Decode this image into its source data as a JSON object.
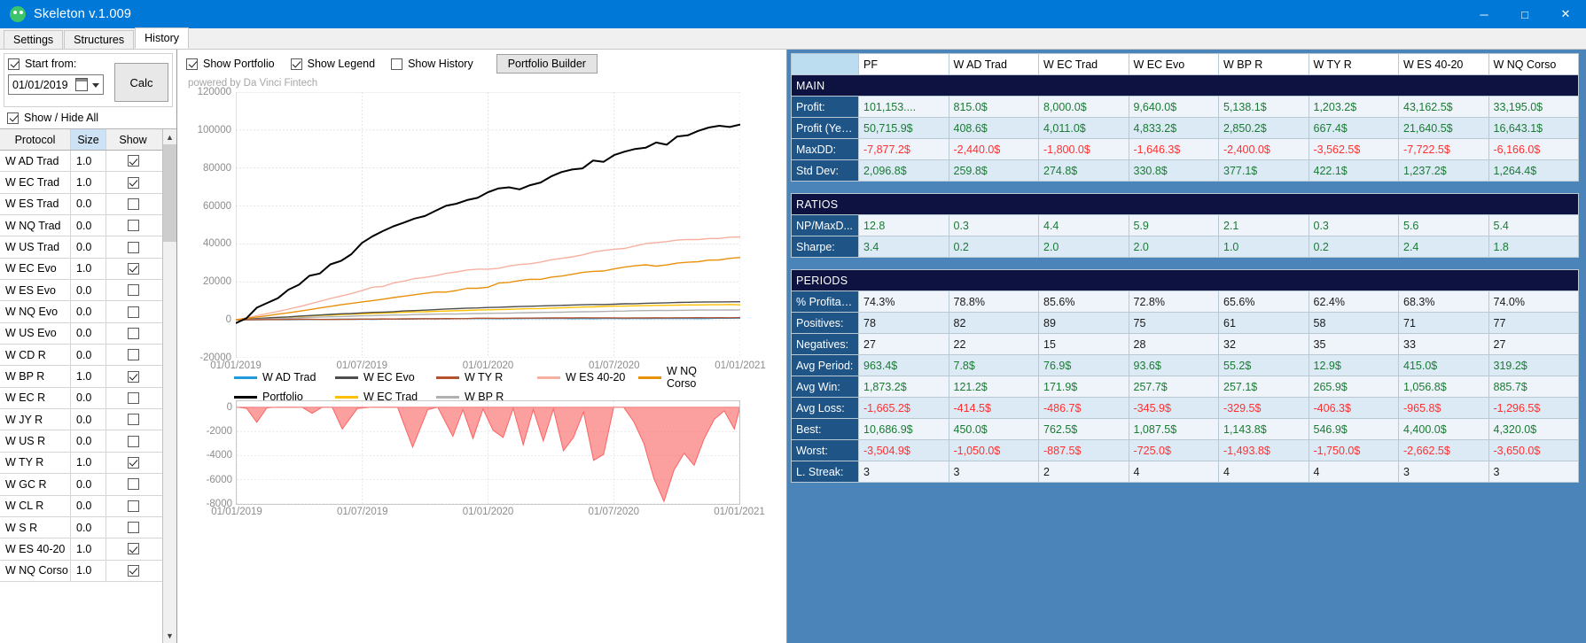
{
  "window": {
    "title": "Skeleton v.1.009",
    "icon": "skull-icon",
    "minimize": "─",
    "maximize": "□",
    "close": "✕"
  },
  "tabs": [
    {
      "label": "Settings",
      "active": false
    },
    {
      "label": "Structures",
      "active": false
    },
    {
      "label": "History",
      "active": true
    }
  ],
  "left": {
    "start_from_label": "Start from:",
    "start_from_checked": true,
    "date_value": "01/01/2019",
    "calc_label": "Calc",
    "show_hide_all_label": "Show / Hide All",
    "show_hide_all_checked": true,
    "columns": [
      "Protocol",
      "Size",
      "Show"
    ],
    "rows": [
      {
        "protocol": "W AD Trad",
        "size": "1.0",
        "show": true
      },
      {
        "protocol": "W EC Trad",
        "size": "1.0",
        "show": true
      },
      {
        "protocol": "W ES Trad",
        "size": "0.0",
        "show": false
      },
      {
        "protocol": "W NQ Trad",
        "size": "0.0",
        "show": false
      },
      {
        "protocol": "W US Trad",
        "size": "0.0",
        "show": false
      },
      {
        "protocol": "W EC Evo",
        "size": "1.0",
        "show": true
      },
      {
        "protocol": "W ES Evo",
        "size": "0.0",
        "show": false
      },
      {
        "protocol": "W NQ Evo",
        "size": "0.0",
        "show": false
      },
      {
        "protocol": "W US Evo",
        "size": "0.0",
        "show": false
      },
      {
        "protocol": "W CD R",
        "size": "0.0",
        "show": false
      },
      {
        "protocol": "W BP R",
        "size": "1.0",
        "show": true
      },
      {
        "protocol": "W EC R",
        "size": "0.0",
        "show": false
      },
      {
        "protocol": "W JY R",
        "size": "0.0",
        "show": false
      },
      {
        "protocol": "W US R",
        "size": "0.0",
        "show": false
      },
      {
        "protocol": "W TY R",
        "size": "1.0",
        "show": true
      },
      {
        "protocol": "W GC R",
        "size": "0.0",
        "show": false
      },
      {
        "protocol": "W CL R",
        "size": "0.0",
        "show": false
      },
      {
        "protocol": "W S R",
        "size": "0.0",
        "show": false
      },
      {
        "protocol": "W ES 40-20",
        "size": "1.0",
        "show": true
      },
      {
        "protocol": "W NQ Corso",
        "size": "1.0",
        "show": true
      }
    ]
  },
  "chart_toolbar": {
    "show_portfolio": {
      "label": "Show Portfolio",
      "checked": true
    },
    "show_legend": {
      "label": "Show Legend",
      "checked": true
    },
    "show_history": {
      "label": "Show History",
      "checked": false
    },
    "portfolio_builder": "Portfolio Builder"
  },
  "chart_data": [
    {
      "type": "line",
      "name": "equity-curve",
      "title": "",
      "watermark": "powered by Da Vinci Fintech",
      "xlabel": "",
      "ylabel": "",
      "ylim": [
        -20000,
        120000
      ],
      "yticks": [
        -20000,
        0,
        20000,
        40000,
        60000,
        80000,
        100000,
        120000
      ],
      "xticks": [
        "01/01/2019",
        "01/07/2019",
        "01/01/2020",
        "01/07/2020",
        "01/01/2021"
      ],
      "grid": true,
      "legend_position": "bottom",
      "x": [
        0,
        4.2,
        8.3,
        12.5,
        16.7,
        20.8,
        25,
        29.2,
        33.3,
        37.5,
        41.7,
        45.8,
        50,
        54.2,
        58.3,
        62.5,
        66.7,
        70.8,
        75,
        79.2,
        83.3,
        87.5,
        91.7,
        95.8,
        100
      ],
      "series": [
        {
          "name": "W AD Trad",
          "color": "#1f9bde",
          "values": [
            0,
            100,
            180,
            240,
            300,
            360,
            400,
            430,
            470,
            510,
            550,
            580,
            610,
            640,
            670,
            690,
            710,
            730,
            750,
            770,
            785,
            795,
            805,
            810,
            815
          ]
        },
        {
          "name": "W EC Trad",
          "color": "#ffc000",
          "values": [
            0,
            500,
            1100,
            1700,
            2200,
            2700,
            3100,
            3500,
            3900,
            4300,
            4700,
            5000,
            5300,
            5600,
            5900,
            6200,
            6500,
            6800,
            7100,
            7350,
            7550,
            7700,
            7850,
            7930,
            8000
          ]
        },
        {
          "name": "W EC Evo",
          "color": "#4d4d4d",
          "values": [
            0,
            600,
            1300,
            2000,
            2600,
            3200,
            3700,
            4200,
            4700,
            5200,
            5700,
            6100,
            6450,
            6800,
            7150,
            7450,
            7750,
            8050,
            8350,
            8650,
            8950,
            9200,
            9400,
            9550,
            9640
          ]
        },
        {
          "name": "W BP R",
          "color": "#b0b0b0",
          "values": [
            0,
            300,
            700,
            1100,
            1400,
            1700,
            2000,
            2300,
            2550,
            2800,
            3050,
            3250,
            3450,
            3650,
            3850,
            4050,
            4250,
            4400,
            4550,
            4700,
            4850,
            4950,
            5050,
            5100,
            5138
          ]
        },
        {
          "name": "W TY R",
          "color": "#b4512e",
          "values": [
            0,
            80,
            150,
            220,
            290,
            360,
            430,
            490,
            550,
            610,
            670,
            720,
            770,
            820,
            870,
            910,
            950,
            990,
            1030,
            1070,
            1110,
            1140,
            1170,
            1190,
            1203
          ]
        },
        {
          "name": "W ES 40-20",
          "color": "#f6b0a0",
          "values": [
            0,
            2200,
            4500,
            7000,
            9800,
            12500,
            15200,
            17500,
            19800,
            22000,
            23800,
            25500,
            27000,
            28500,
            30000,
            31800,
            33800,
            35800,
            37500,
            39000,
            40200,
            41200,
            42100,
            42700,
            43162
          ]
        },
        {
          "name": "W NQ Corso",
          "color": "#e8910c",
          "values": [
            0,
            1400,
            2900,
            4500,
            6200,
            7900,
            9500,
            11000,
            12500,
            14000,
            15400,
            16700,
            18000,
            19300,
            20600,
            22000,
            23400,
            24800,
            26200,
            27600,
            29000,
            30200,
            31400,
            32400,
            33195
          ]
        },
        {
          "name": "Portfolio",
          "color": "#000000",
          "values": [
            0,
            6500,
            13500,
            20500,
            27000,
            33500,
            39000,
            44500,
            49800,
            54500,
            58500,
            62500,
            66000,
            69500,
            73000,
            76500,
            80500,
            84000,
            87500,
            90500,
            93500,
            96000,
            98000,
            99800,
            101153
          ]
        }
      ]
    },
    {
      "type": "area",
      "name": "drawdown-curve",
      "color": "#fa6464",
      "ylim": [
        -8000,
        500
      ],
      "yticks": [
        0,
        -2000,
        -4000,
        -6000,
        -8000
      ],
      "xticks": [
        "01/01/2019",
        "01/07/2019",
        "01/01/2020",
        "01/07/2020",
        "01/01/2021"
      ],
      "x": [
        0,
        2,
        4,
        6,
        8,
        11,
        13,
        15,
        17,
        19,
        21,
        24,
        27,
        30,
        32,
        35,
        38,
        40,
        43,
        45,
        47,
        49,
        51,
        53,
        55,
        57,
        59,
        61,
        63,
        65,
        67,
        69,
        71,
        73,
        75,
        77,
        79,
        81,
        83,
        85,
        87,
        89,
        91,
        93,
        95,
        97,
        99,
        100
      ],
      "values": [
        0,
        -100,
        -1250,
        -50,
        0,
        0,
        0,
        -500,
        0,
        0,
        -1800,
        -100,
        0,
        0,
        0,
        -3300,
        -200,
        0,
        -2400,
        -200,
        -2600,
        -150,
        -1900,
        -2500,
        -100,
        -3100,
        -200,
        -2800,
        -150,
        -3600,
        -2500,
        -400,
        -4400,
        -3900,
        0,
        0,
        -1200,
        -3000,
        -5900,
        -7800,
        -5200,
        -3800,
        -4800,
        -2600,
        -1000,
        -300,
        -1800,
        -200
      ]
    }
  ],
  "legend": [
    {
      "label": "W AD Trad",
      "color": "#1f9bde"
    },
    {
      "label": "W EC Evo",
      "color": "#4d4d4d"
    },
    {
      "label": "W TY R",
      "color": "#b4512e"
    },
    {
      "label": "W ES 40-20",
      "color": "#f6b0a0"
    },
    {
      "label": "W NQ Corso",
      "color": "#e8910c"
    },
    {
      "label": "Portfolio",
      "color": "#000000"
    },
    {
      "label": "W EC Trad",
      "color": "#ffc000"
    },
    {
      "label": "W BP R",
      "color": "#b0b0b0"
    }
  ],
  "stats": {
    "columns": [
      "",
      "PF",
      "W AD Trad",
      "W EC Trad",
      "W EC Evo",
      "W BP R",
      "W TY R",
      "W ES 40-20",
      "W NQ Corso"
    ],
    "sections": [
      {
        "title": "MAIN",
        "rows": [
          {
            "label": "Profit:",
            "values": [
              "101,153....",
              "815.0$",
              "8,000.0$",
              "9,640.0$",
              "5,138.1$",
              "1,203.2$",
              "43,162.5$",
              "33,195.0$"
            ],
            "tone": "pos"
          },
          {
            "label": "Profit (Year):",
            "values": [
              "50,715.9$",
              "408.6$",
              "4,011.0$",
              "4,833.2$",
              "2,850.2$",
              "667.4$",
              "21,640.5$",
              "16,643.1$"
            ],
            "tone": "pos"
          },
          {
            "label": "MaxDD:",
            "values": [
              "-7,877.2$",
              "-2,440.0$",
              "-1,800.0$",
              "-1,646.3$",
              "-2,400.0$",
              "-3,562.5$",
              "-7,722.5$",
              "-6,166.0$"
            ],
            "tone": "neg"
          },
          {
            "label": "Std Dev:",
            "values": [
              "2,096.8$",
              "259.8$",
              "274.8$",
              "330.8$",
              "377.1$",
              "422.1$",
              "1,237.2$",
              "1,264.4$"
            ],
            "tone": "pos"
          }
        ]
      },
      {
        "title": "RATIOS",
        "rows": [
          {
            "label": "NP/MaxD...",
            "values": [
              "12.8",
              "0.3",
              "4.4",
              "5.9",
              "2.1",
              "0.3",
              "5.6",
              "5.4"
            ],
            "tone": "pos"
          },
          {
            "label": "Sharpe:",
            "values": [
              "3.4",
              "0.2",
              "2.0",
              "2.0",
              "1.0",
              "0.2",
              "2.4",
              "1.8"
            ],
            "tone": "pos"
          }
        ]
      },
      {
        "title": "PERIODS",
        "rows": [
          {
            "label": "% Profitable:",
            "values": [
              "74.3%",
              "78.8%",
              "85.6%",
              "72.8%",
              "65.6%",
              "62.4%",
              "68.3%",
              "74.0%"
            ],
            "tone": "neu"
          },
          {
            "label": "Positives:",
            "values": [
              "78",
              "82",
              "89",
              "75",
              "61",
              "58",
              "71",
              "77"
            ],
            "tone": "neu"
          },
          {
            "label": "Negatives:",
            "values": [
              "27",
              "22",
              "15",
              "28",
              "32",
              "35",
              "33",
              "27"
            ],
            "tone": "neu"
          },
          {
            "label": "Avg Period:",
            "values": [
              "963.4$",
              "7.8$",
              "76.9$",
              "93.6$",
              "55.2$",
              "12.9$",
              "415.0$",
              "319.2$"
            ],
            "tone": "pos"
          },
          {
            "label": "Avg Win:",
            "values": [
              "1,873.2$",
              "121.2$",
              "171.9$",
              "257.7$",
              "257.1$",
              "265.9$",
              "1,056.8$",
              "885.7$"
            ],
            "tone": "pos"
          },
          {
            "label": "Avg Loss:",
            "values": [
              "-1,665.2$",
              "-414.5$",
              "-486.7$",
              "-345.9$",
              "-329.5$",
              "-406.3$",
              "-965.8$",
              "-1,296.5$"
            ],
            "tone": "neg"
          },
          {
            "label": "Best:",
            "values": [
              "10,686.9$",
              "450.0$",
              "762.5$",
              "1,087.5$",
              "1,143.8$",
              "546.9$",
              "4,400.0$",
              "4,320.0$"
            ],
            "tone": "pos"
          },
          {
            "label": "Worst:",
            "values": [
              "-3,504.9$",
              "-1,050.0$",
              "-887.5$",
              "-725.0$",
              "-1,493.8$",
              "-1,750.0$",
              "-2,662.5$",
              "-3,650.0$"
            ],
            "tone": "neg"
          },
          {
            "label": "L. Streak:",
            "values": [
              "3",
              "3",
              "2",
              "4",
              "4",
              "4",
              "3",
              "3"
            ],
            "tone": "neu"
          }
        ]
      }
    ]
  }
}
